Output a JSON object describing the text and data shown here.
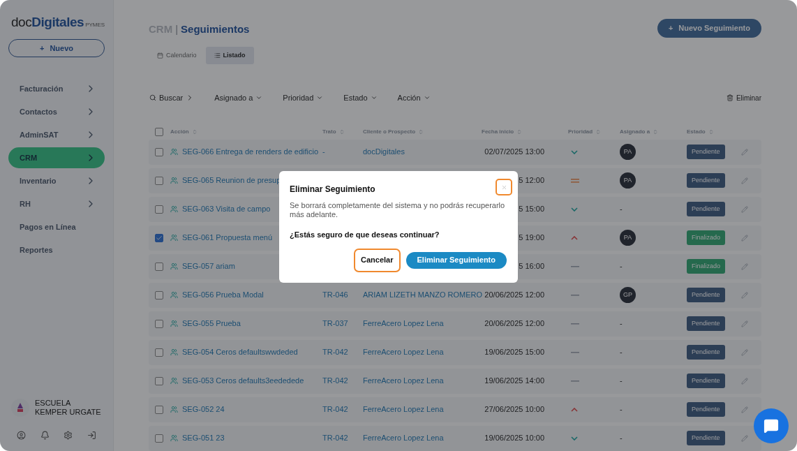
{
  "sidebar": {
    "logo": {
      "prefix": "doc",
      "name": "Digitales",
      "suffix": "PYMES"
    },
    "new_button": {
      "icon": "+",
      "label": "Nuevo"
    },
    "items": [
      {
        "label": "Facturación",
        "has_children": true,
        "selected": false
      },
      {
        "label": "Contactos",
        "has_children": true,
        "selected": false
      },
      {
        "label": "AdminSAT",
        "has_children": true,
        "selected": false
      },
      {
        "label": "CRM",
        "has_children": true,
        "selected": true
      },
      {
        "label": "Inventario",
        "has_children": true,
        "selected": false
      },
      {
        "label": "RH",
        "has_children": true,
        "selected": false
      },
      {
        "label": "Pagos en Línea",
        "has_children": false,
        "selected": false
      },
      {
        "label": "Reportes",
        "has_children": false,
        "selected": false
      }
    ],
    "organization": "ESCUELA KEMPER URGATE"
  },
  "header": {
    "section": "CRM",
    "separator": "|",
    "page": "Seguimientos",
    "new_button": "Nuevo Seguimiento"
  },
  "tabs": [
    {
      "label": "Calendario",
      "kind": "calendar",
      "selected": false
    },
    {
      "label": "Listado",
      "kind": "list",
      "selected": true
    }
  ],
  "filters": {
    "search": "Buscar",
    "dropdowns": [
      "Asignado a",
      "Prioridad",
      "Estado",
      "Acción"
    ],
    "delete": "Eliminar"
  },
  "table": {
    "select_all_checked": false,
    "columns": [
      "Acción",
      "Trato",
      "Cliente o Prospecto",
      "Fecha inicio",
      "Prioridad",
      "Asignado a",
      "Estado"
    ],
    "rows": [
      {
        "checked": false,
        "action": "SEG-066 Entrega de renders de edificio",
        "deal": "-",
        "client": "docDigitales",
        "date": "02/07/2025 13:00",
        "priority": {
          "kind": "low"
        },
        "assignee": "PA",
        "status": {
          "label": "Pendiente",
          "kind": "pending"
        }
      },
      {
        "checked": false,
        "action": "SEG-065 Reunion de presup",
        "date": "5 12:00",
        "priority": {
          "kind": "medium"
        },
        "assignee": "PA",
        "status": {
          "label": "Pendiente",
          "kind": "pending"
        }
      },
      {
        "checked": false,
        "action": "SEG-063 Visita de campo",
        "date": "5 15:00",
        "priority": {
          "kind": "low"
        },
        "assignee": "-",
        "status": {
          "label": "Pendiente",
          "kind": "pending"
        }
      },
      {
        "checked": true,
        "action": "SEG-061 Propuesta menú",
        "date": "5 19:00",
        "priority": {
          "kind": "high"
        },
        "assignee": "PA",
        "status": {
          "label": "Finalizado",
          "kind": "done"
        }
      },
      {
        "checked": false,
        "action": "SEG-057 ariam",
        "date": "5 16:00",
        "priority": {
          "kind": "none"
        },
        "assignee": "-",
        "status": {
          "label": "Finalizado",
          "kind": "done"
        }
      },
      {
        "checked": false,
        "action": "SEG-056 Prueba Modal",
        "deal": "TR-046",
        "client": "ARIAM LIZETH MANZO ROMERO",
        "date": "20/06/2025 12:00",
        "priority": {
          "kind": "none"
        },
        "assignee": "GP",
        "status": {
          "label": "Pendiente",
          "kind": "pending"
        }
      },
      {
        "checked": false,
        "action": "SEG-055 Prueba",
        "deal": "TR-037",
        "client": "FerreAcero Lopez Lena",
        "date": "20/06/2025 12:00",
        "priority": {
          "kind": "none"
        },
        "assignee": "-",
        "status": {
          "label": "Pendiente",
          "kind": "pending"
        }
      },
      {
        "checked": false,
        "action": "SEG-054 Ceros defaultswwdeded",
        "deal": "TR-042",
        "client": "FerreAcero Lopez Lena",
        "date": "19/06/2025 15:00",
        "priority": {
          "kind": "none"
        },
        "assignee": "-",
        "status": {
          "label": "Pendiente",
          "kind": "pending"
        }
      },
      {
        "checked": false,
        "action": "SEG-053 Ceros defaults3eededede",
        "deal": "TR-042",
        "client": "FerreAcero Lopez Lena",
        "date": "19/06/2025 14:00",
        "priority": {
          "kind": "none"
        },
        "assignee": "-",
        "status": {
          "label": "Pendiente",
          "kind": "pending"
        }
      },
      {
        "checked": false,
        "action": "SEG-052 24",
        "deal": "TR-042",
        "client": "FerreAcero Lopez Lena",
        "date": "27/06/2025 10:00",
        "priority": {
          "kind": "high"
        },
        "assignee": "-",
        "status": {
          "label": "Pendiente",
          "kind": "pending"
        }
      },
      {
        "checked": false,
        "action": "SEG-051 23",
        "deal": "TR-042",
        "client": "FerreAcero Lopez Lena",
        "date": "19/06/2025 10:00",
        "priority": {
          "kind": "low"
        },
        "assignee": "-",
        "status": {
          "label": "Pendiente",
          "kind": "pending"
        }
      }
    ]
  },
  "dialog": {
    "title": "Eliminar Seguimiento",
    "close_focused": true,
    "message": "Se borrará completamente del sistema y no podrás recuperarlo más adelante.",
    "question": "¿Estás seguro de que deseas continuar?",
    "buttons": [
      {
        "label": "Cancelar",
        "kind": "secondary",
        "focused": true
      },
      {
        "label": "Eliminar Seguimiento",
        "kind": "primary",
        "focused": false
      }
    ]
  }
}
